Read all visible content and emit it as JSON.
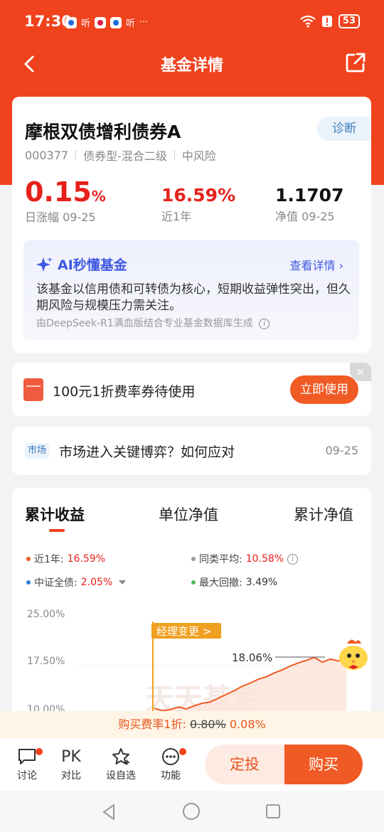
{
  "status": {
    "time": "17:30",
    "notif_text_1": "听",
    "notif_text_2": "听",
    "more": "···",
    "battery": "53"
  },
  "nav": {
    "title": "基金详情"
  },
  "fund": {
    "name": "摩根双债增利债券A",
    "diag_label": "诊断",
    "code": "000377",
    "type": "债券型-混合二级",
    "risk": "中风险",
    "daily_change": "0.15",
    "daily_change_unit": "%",
    "daily_label": "日涨幅 09-25",
    "year_return": "16.59%",
    "year_label": "近1年",
    "nav_value": "1.1707",
    "nav_label": "净值 09-25"
  },
  "ai": {
    "title": "AI秒懂基金",
    "link": "查看详情",
    "body": "该基金以信用债和可转债为核心，短期收益弹性突出，但久期风险与规模压力需关注。",
    "footer": "由DeepSeek-R1满血版结合专业基金数据库生成"
  },
  "coupon": {
    "text": "100元1折费率券待使用",
    "button": "立即使用",
    "close": "×"
  },
  "news": {
    "tag": "市场",
    "title": "市场进入关键博弈？如何应对",
    "date": "09-25"
  },
  "chart_tabs": [
    "累计收益",
    "单位净值",
    "累计净值"
  ],
  "legend": {
    "year_label": "近1年:",
    "year_value": "16.59%",
    "avg_label": "同类平均:",
    "avg_value": "10.58%",
    "bench_label": "中证全债:",
    "bench_value": "2.05%",
    "drawdown_label": "最大回撤:",
    "drawdown_value": "3.49%",
    "colors": {
      "year": "#f05a24",
      "avg": "#999999",
      "bench": "#2f7fd8",
      "drawdown": "#4cb858"
    }
  },
  "chart_data": {
    "type": "area",
    "yticks": [
      "25.00%",
      "17.50%",
      "10.00%"
    ],
    "annotation_manager": "经理变更 >",
    "peak_label": "18.06%",
    "watermark": "天天基金",
    "series": [
      {
        "values": [
          10,
          9.6,
          9.8,
          10.2,
          9.9,
          10.4,
          10.8,
          11.0,
          11.6,
          12.2,
          12.8,
          13.5,
          14.0,
          14.6,
          15.0,
          15.6,
          16.1,
          16.7,
          17.2,
          17.6,
          18.06,
          17.3,
          17.8,
          17.5,
          18.0
        ]
      }
    ]
  },
  "fee": {
    "label": "购买费率1折:",
    "old": "0.80%",
    "new": "0.08%"
  },
  "bottom": {
    "discuss": "讨论",
    "pk_icon": "PK",
    "compare": "对比",
    "watchlist": "设自选",
    "func": "功能",
    "dingtou": "定投",
    "buy": "购买"
  }
}
